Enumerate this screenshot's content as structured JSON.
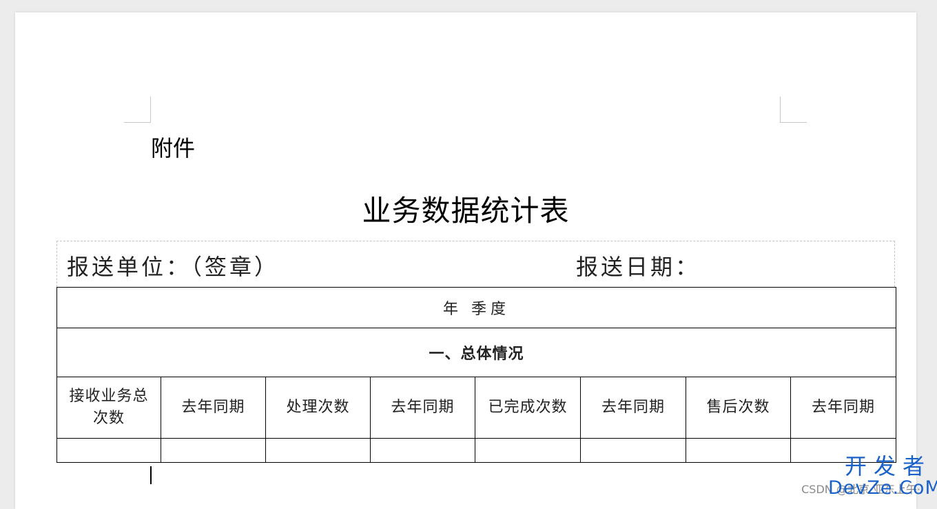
{
  "document": {
    "attachment_label": "附件",
    "title": "业务数据统计表",
    "sender_unit": "报送单位：（签章）",
    "report_date": "报送日期：",
    "period": "年  季度",
    "section_title": "一、总体情况",
    "headers": [
      "接收业务总次数",
      "去年同期",
      "处理次数",
      "去年同期",
      "已完成次数",
      "去年同期",
      "售后次数",
      "去年同期"
    ],
    "data_row": [
      "",
      "",
      "",
      "",
      "",
      "",
      "",
      ""
    ]
  },
  "watermark": {
    "csdn": "CSDN @北京·亚东上午·",
    "brand_top": "开发者",
    "brand_bottom": "DevZe.CoM"
  },
  "colors": {
    "brand": "#1a62c9",
    "table_border": "#000000"
  }
}
